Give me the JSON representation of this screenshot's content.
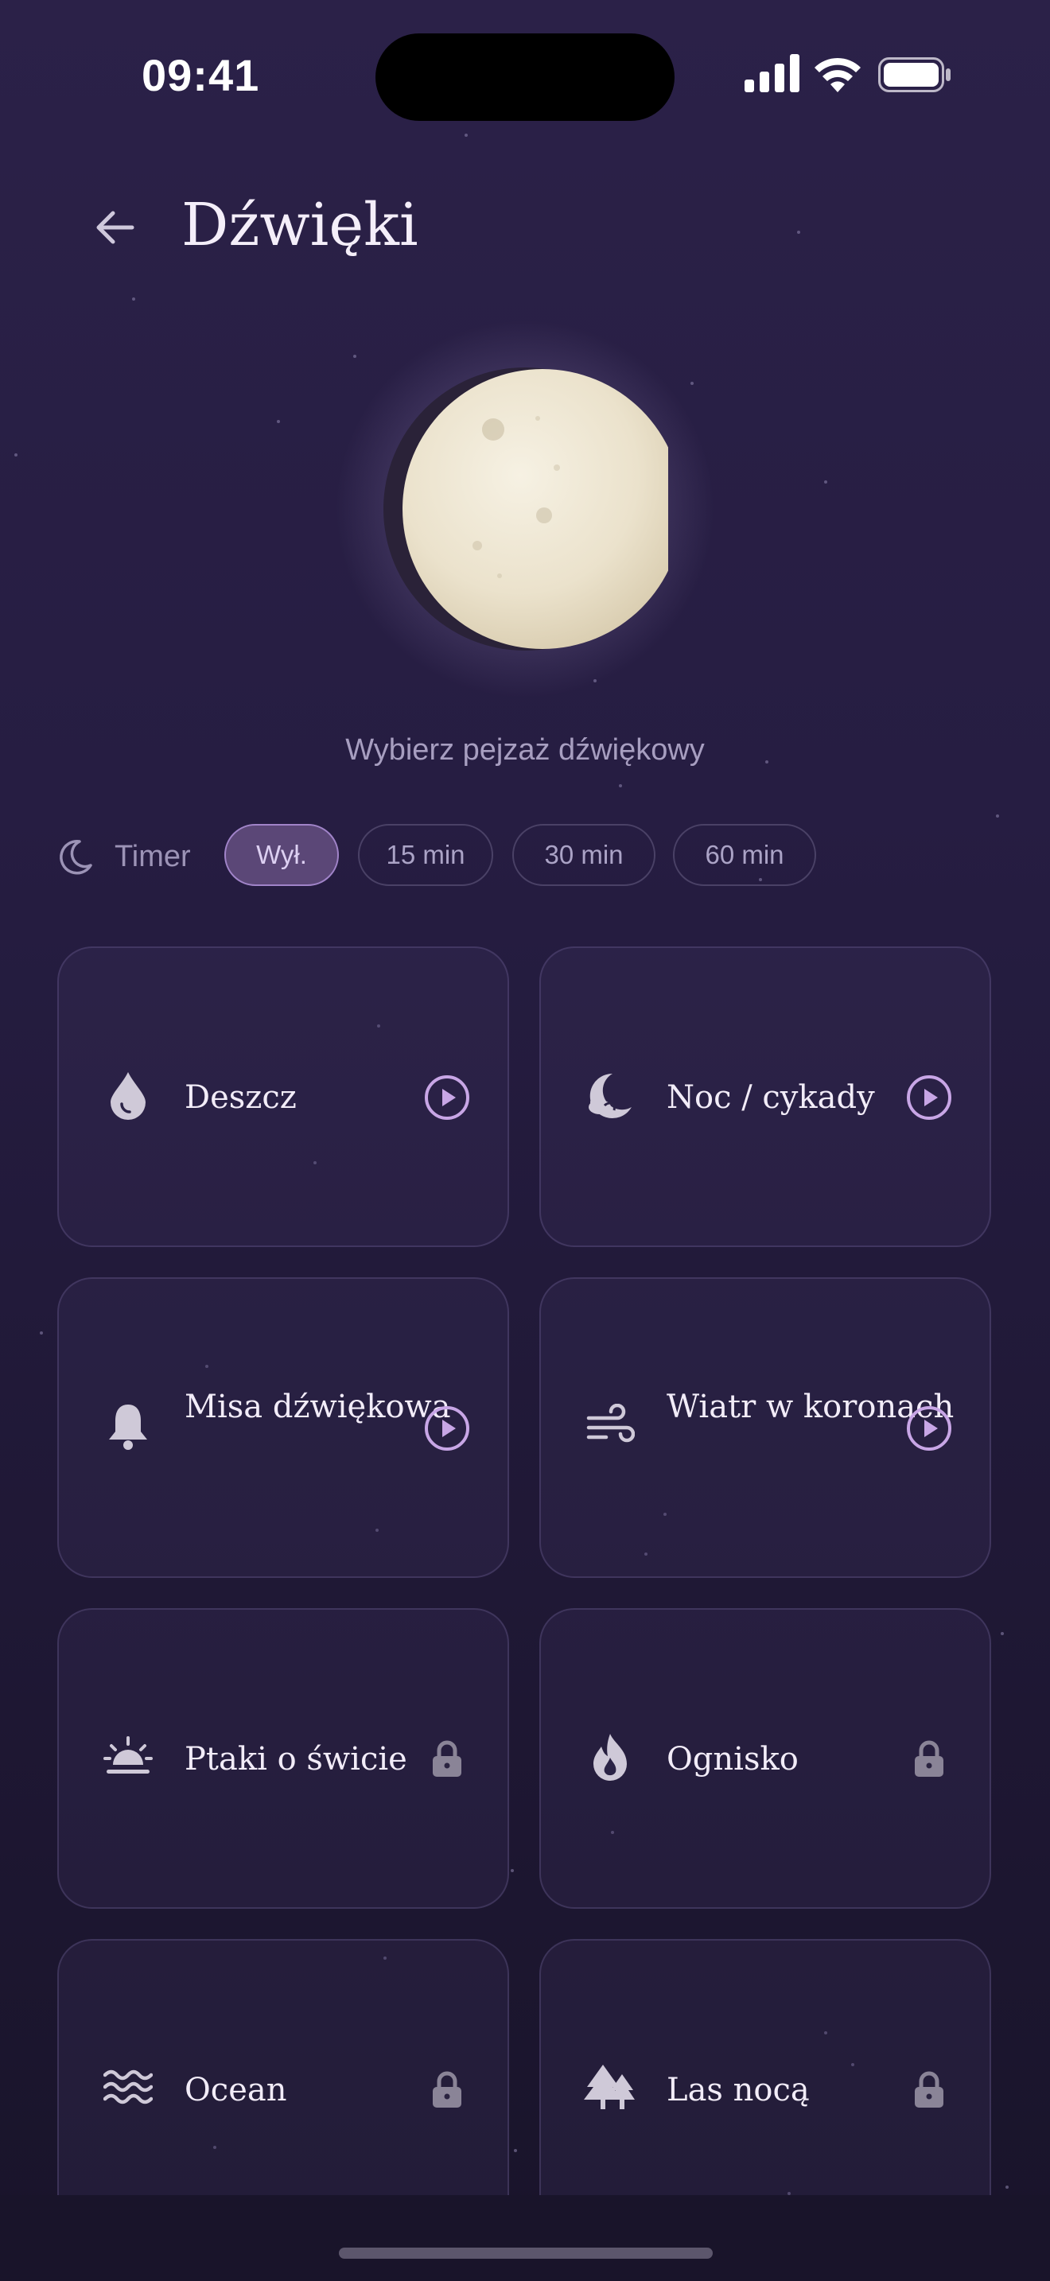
{
  "status_bar": {
    "time": "09:41"
  },
  "header": {
    "title": "Dźwięki"
  },
  "subtitle": "Wybierz pejzaż dźwiękowy",
  "timer": {
    "label": "Timer",
    "options": [
      "Wył.",
      "15 min",
      "30 min",
      "60 min"
    ],
    "selected": "Wył."
  },
  "sounds": [
    {
      "label": "Deszcz",
      "icon": "raindrop-icon",
      "state": "play"
    },
    {
      "label": "Noc / cykady",
      "icon": "moon-cloud-icon",
      "state": "play"
    },
    {
      "label": "Misa dźwiękowa",
      "icon": "bell-icon",
      "state": "play"
    },
    {
      "label": "Wiatr w koronach",
      "icon": "wind-icon",
      "state": "play"
    },
    {
      "label": "Ptaki o świcie",
      "icon": "sunrise-icon",
      "state": "locked"
    },
    {
      "label": "Ognisko",
      "icon": "flame-icon",
      "state": "locked"
    },
    {
      "label": "Ocean",
      "icon": "waves-icon",
      "state": "locked"
    },
    {
      "label": "Las nocą",
      "icon": "trees-icon",
      "state": "locked"
    }
  ],
  "colors": {
    "accent": "#c8a6e6",
    "background": "#261d42",
    "chip_active": "#5b4777",
    "lock": "#8a8497"
  }
}
